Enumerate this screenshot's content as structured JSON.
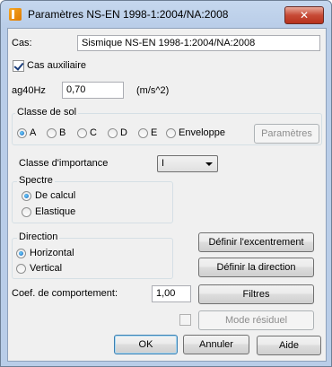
{
  "window": {
    "title": "Paramètres NS-EN 1998-1:2004/NA:2008",
    "close_glyph": "✕"
  },
  "cas": {
    "label": "Cas:",
    "value": "Sismique NS-EN 1998-1:2004/NA:2008"
  },
  "cas_auxiliaire": {
    "label": "Cas auxiliaire",
    "checked": true
  },
  "ag40": {
    "label": "ag40Hz",
    "value": "0,70",
    "unit": "(m/s^2)"
  },
  "classe_sol": {
    "title": "Classe de sol",
    "options": [
      "A",
      "B",
      "C",
      "D",
      "E",
      "Enveloppe"
    ],
    "selected": "A",
    "params_button": "Paramètres"
  },
  "classe_importance": {
    "label": "Classe d'importance",
    "value": "I"
  },
  "spectre": {
    "title": "Spectre",
    "options": [
      "De calcul",
      "Elastique"
    ],
    "selected": "De calcul"
  },
  "direction": {
    "title": "Direction",
    "options": [
      "Horizontal",
      "Vertical"
    ],
    "selected": "Horizontal"
  },
  "buttons": {
    "excentrement": "Définir l'excentrement",
    "direction": "Définir la direction",
    "filtres": "Filtres",
    "mode_residuel": "Mode résiduel",
    "ok": "OK",
    "annuler": "Annuler",
    "aide": "Aide"
  },
  "coef": {
    "label": "Coef. de comportement:",
    "value": "1,00"
  }
}
